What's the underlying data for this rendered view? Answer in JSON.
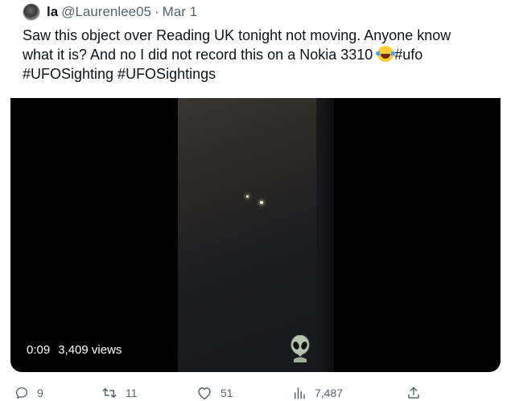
{
  "tweet": {
    "display_name": "la",
    "handle": "@Laurenlee05",
    "separator": "·",
    "date": "Mar 1",
    "text_line1": "Saw this object over Reading UK tonight not moving. Anyone know",
    "text_line2_pre": "what it is? And no I did not record this on a Nokia 3310 ",
    "text_line2_emoji": "face-with-tears-of-joy",
    "text_line2_tag": "#ufo",
    "text_line3": "#UFOSighting #UFOSightings"
  },
  "media": {
    "timestamp": "0:09",
    "views": "3,409 views",
    "overlay_icon": "alien-icon"
  },
  "actions": {
    "replies": "9",
    "retweets": "11",
    "likes": "51",
    "views": "7,487"
  },
  "icons": {
    "reply": "reply-icon",
    "retweet": "retweet-icon",
    "like": "heart-icon",
    "views": "views-chart-icon",
    "share": "share-icon"
  },
  "colors": {
    "text": "#0f1419",
    "muted": "#536471",
    "media_bg": "#000000"
  }
}
